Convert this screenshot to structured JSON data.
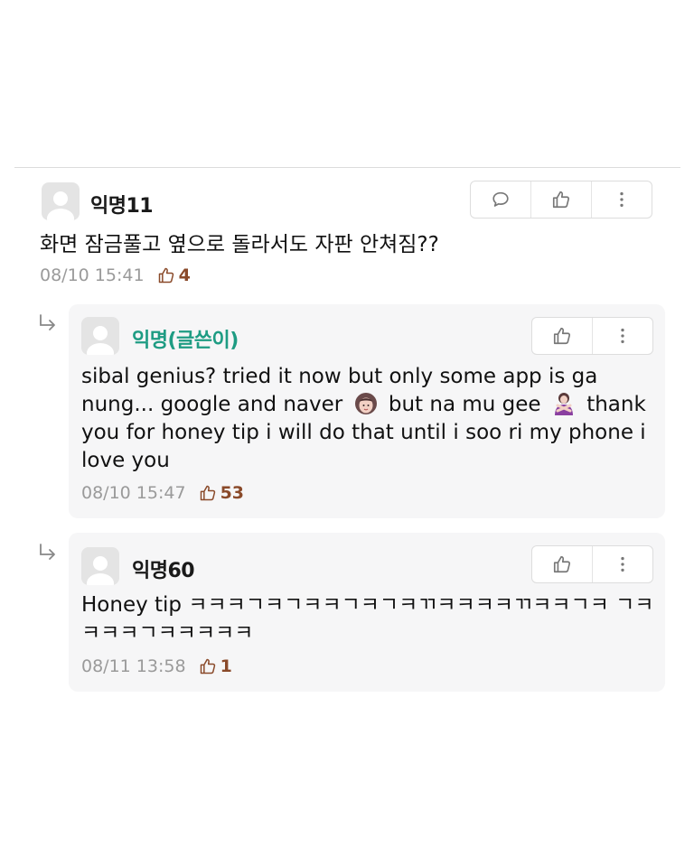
{
  "comments": [
    {
      "author": "익명11",
      "text": "화면 잠금풀고 옆으로 돌라서도 자판 안쳐짐??",
      "datetime": "08/10 15:41",
      "likes": "4"
    },
    {
      "author": "익명(글쓴이)",
      "text_parts": [
        "sibal genius? tried it now but only some app is ga nung... google and naver",
        "but na mu gee",
        "thank you for honey tip i will do that until i soo ri my phone i love you"
      ],
      "datetime": "08/10 15:47",
      "likes": "53"
    },
    {
      "author": "익명60",
      "text": "Honey tip ㅋㅋㅋㄱㅋㄱㅋㅋㄱㅋㄱㅋㄲㅋㅋㅋㅋㄲㅋㅋㄱㅋ ㄱㅋㅋㅋㅋㄱㅋㅋㅋㅋㅋ",
      "datetime": "08/11 13:58",
      "likes": "1"
    }
  ],
  "icons": {
    "reply": "speech-bubble-icon",
    "like": "thumbs-up-icon",
    "more": "more-vertical-icon",
    "reply_arrow": "reply-arrow-icon",
    "avatar": "default-avatar-icon"
  },
  "colors": {
    "op_author": "#1e9c83",
    "like_count": "#8a4a2a",
    "meta_text": "#9a9a9a",
    "reply_background": "#f6f6f7"
  }
}
